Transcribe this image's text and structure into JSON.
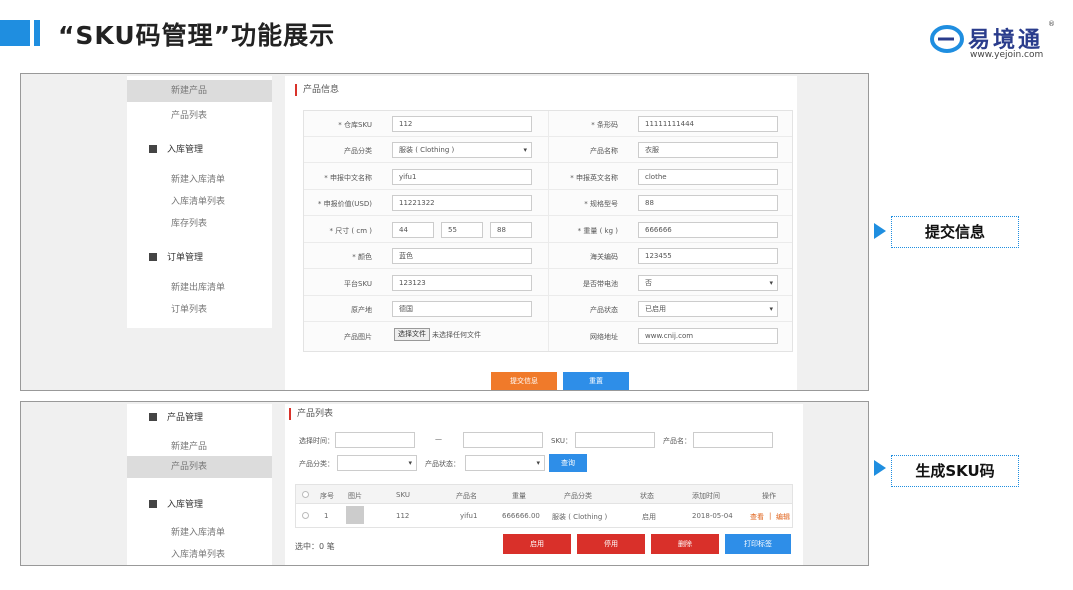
{
  "header": {
    "title": "“SKU码管理”功能展示",
    "logo_text": "易境通",
    "logo_url": "www.yejoin.com",
    "logo_reg": "®",
    "accent": "#1f8ee0"
  },
  "panel1": {
    "sidebar": {
      "items_top": [
        "新建产品",
        "产品列表"
      ],
      "group1": "入库管理",
      "group1_items": [
        "新建入库清单",
        "入库清单列表",
        "库存列表"
      ],
      "group2": "订单管理",
      "group2_items": [
        "新建出库清单",
        "订单列表"
      ]
    },
    "section_title": "产品信息",
    "form": {
      "sku_label": "* 仓库SKU",
      "sku_value": "112",
      "barcode_label": "* 条形码",
      "barcode_value": "11111111444",
      "category_label": "产品分类",
      "category_value": "服装 ( Clothing )",
      "name_label": "产品名称",
      "name_value": "衣服",
      "cn_decl_label": "* 申报中文名称",
      "cn_decl_value": "yifu1",
      "en_decl_label": "* 申报英文名称",
      "en_decl_value": "clothe",
      "decl_value_label": "* 申报价值(USD)",
      "decl_value_value": "11221322",
      "spec_label": "* 规格型号",
      "spec_value": "88",
      "size_label": "* 尺寸 ( cm )",
      "size_l": "44",
      "size_w": "55",
      "size_h": "88",
      "weight_label": "* 重量 ( kg )",
      "weight_value": "666666",
      "color_label": "* 颜色",
      "color_value": "蓝色",
      "hs_label": "海关编码",
      "hs_value": "123455",
      "platform_sku_label": "平台SKU",
      "platform_sku_value": "123123",
      "battery_label": "是否带电池",
      "battery_value": "否",
      "origin_label": "原产地",
      "origin_value": "德国",
      "status_label": "产品状态",
      "status_value": "已启用",
      "image_label": "产品图片",
      "file_button": "选择文件",
      "file_text": "未选择任何文件",
      "url_label": "网络地址",
      "url_value": "www.cnij.com"
    },
    "submit_button": "提交信息",
    "reset_button": "重置"
  },
  "panel2": {
    "sidebar": {
      "group0": "产品管理",
      "group0_items": [
        "新建产品",
        "产品列表"
      ],
      "group1": "入库管理",
      "group1_items": [
        "新建入库清单",
        "入库清单列表"
      ]
    },
    "section_title": "产品列表",
    "filters": {
      "time_label": "选择时间：",
      "dash": "—",
      "sku_label": "SKU：",
      "name_label": "产品名：",
      "category_label": "产品分类：",
      "status_label": "产品状态：",
      "search_button": "查询"
    },
    "table": {
      "headers": [
        "序号",
        "图片",
        "SKU",
        "产品名",
        "重量",
        "产品分类",
        "状态",
        "添加时间",
        "操作"
      ],
      "rows": [
        {
          "index": "1",
          "sku": "112",
          "name": "yifu1",
          "weight": "666666.00",
          "category": "服装 ( Clothing )",
          "status": "启用",
          "date": "2018-05-04",
          "op_view": "查看",
          "op_sep": "|",
          "op_edit": "编辑"
        }
      ]
    },
    "selected_text": "选中：0 笔",
    "actions": [
      "启用",
      "停用",
      "删除",
      "打印标签"
    ]
  },
  "callouts": {
    "submit_info": "提交信息",
    "generate_sku": "生成SKU码"
  }
}
